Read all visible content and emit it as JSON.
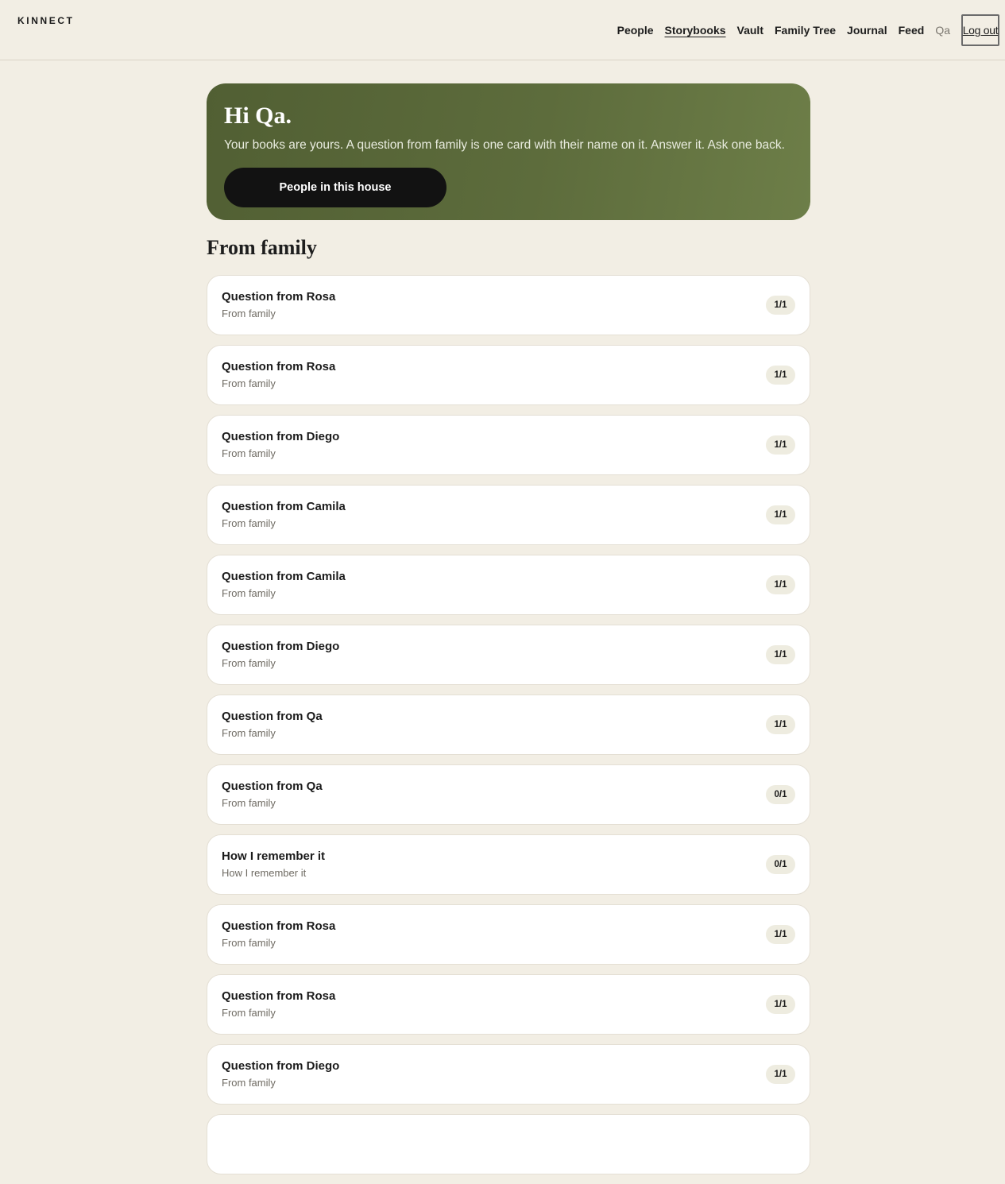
{
  "brand": "KINNECT",
  "nav": {
    "links": [
      {
        "label": "People",
        "active": false
      },
      {
        "label": "Storybooks",
        "active": true
      },
      {
        "label": "Vault",
        "active": false
      },
      {
        "label": "Family Tree",
        "active": false
      },
      {
        "label": "Journal",
        "active": false
      },
      {
        "label": "Feed",
        "active": false
      }
    ],
    "user": "Qa",
    "logout_label": "Log out"
  },
  "hero": {
    "title": "Hi Qa.",
    "subtitle": "Your books are yours. A question from family is one card with their name on it. Answer it. Ask one back.",
    "button_label": "People in this house"
  },
  "section": {
    "title": "From family"
  },
  "cards": [
    {
      "title": "Question from Rosa",
      "subtitle": "From family",
      "progress": "1/1"
    },
    {
      "title": "Question from Rosa",
      "subtitle": "From family",
      "progress": "1/1"
    },
    {
      "title": "Question from Diego",
      "subtitle": "From family",
      "progress": "1/1"
    },
    {
      "title": "Question from Camila",
      "subtitle": "From family",
      "progress": "1/1"
    },
    {
      "title": "Question from Camila",
      "subtitle": "From family",
      "progress": "1/1"
    },
    {
      "title": "Question from Diego",
      "subtitle": "From family",
      "progress": "1/1"
    },
    {
      "title": "Question from Qa",
      "subtitle": "From family",
      "progress": "1/1"
    },
    {
      "title": "Question from Qa",
      "subtitle": "From family",
      "progress": "0/1"
    },
    {
      "title": "How I remember it",
      "subtitle": "How I remember it",
      "progress": "0/1"
    },
    {
      "title": "Question from Rosa",
      "subtitle": "From family",
      "progress": "1/1"
    },
    {
      "title": "Question from Rosa",
      "subtitle": "From family",
      "progress": "1/1"
    },
    {
      "title": "Question from Diego",
      "subtitle": "From family",
      "progress": "1/1"
    },
    {
      "title": "",
      "subtitle": "",
      "progress": ""
    }
  ]
}
